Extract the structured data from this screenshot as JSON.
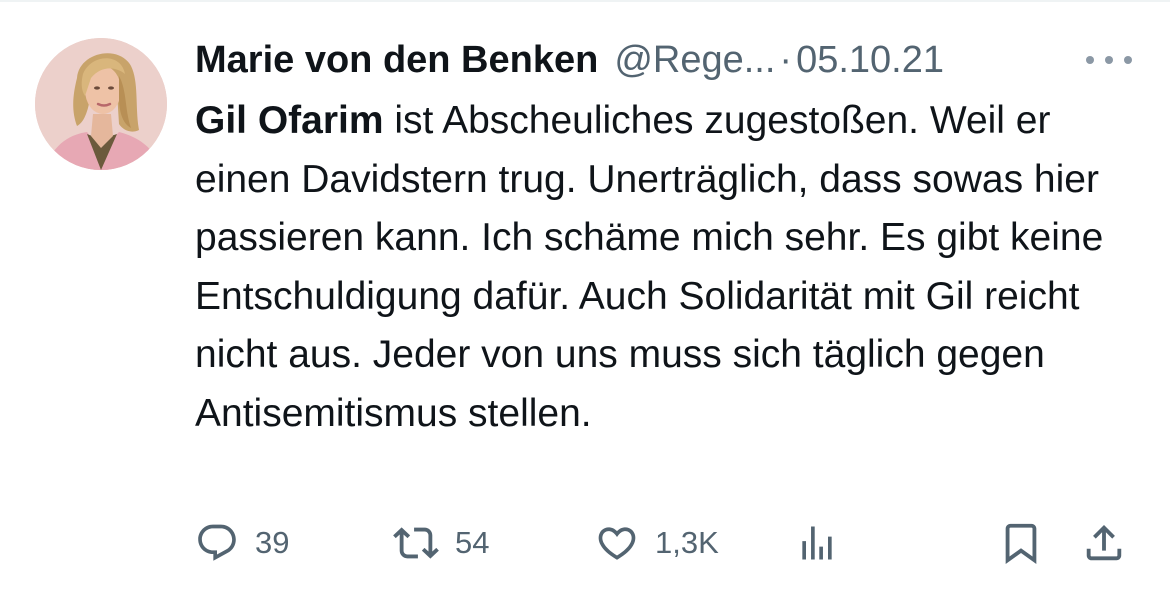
{
  "tweet": {
    "author_name": "Marie von den Benken",
    "handle": "@Rege...",
    "separator": "·",
    "date": "05.10.21",
    "mention": "Gil Ofarim",
    "text": " ist Abscheuliches zugestoßen. Weil er einen Davidstern trug. Unerträglich, dass sowas hier passieren kann. Ich schäme mich sehr. Es gibt keine Entschuldigung dafür. Auch Solidarität mit Gil reicht nicht aus. Jeder von uns muss sich täglich gegen Antisemitismus stellen."
  },
  "actions": {
    "reply_count": "39",
    "retweet_count": "54",
    "like_count": "1,3K"
  },
  "icons": {
    "more": "more-icon",
    "reply": "reply-icon",
    "retweet": "retweet-icon",
    "like": "heart-icon",
    "views": "views-icon",
    "bookmark": "bookmark-icon",
    "share": "share-icon"
  },
  "colors": {
    "text_primary": "#0f1419",
    "text_secondary": "#536471",
    "background": "#ffffff"
  }
}
